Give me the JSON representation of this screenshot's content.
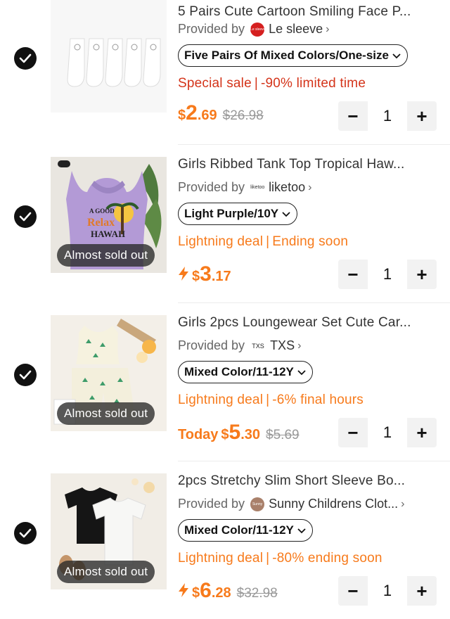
{
  "colors": {
    "accent": "#f77a1b",
    "sale": "#d4341a",
    "check": "#111111"
  },
  "items": [
    {
      "title": "5 Pairs Cute Cartoon Smiling Face P...",
      "provided_label": "Provided by",
      "shop_name": "Le sleeve",
      "shop_logo_text": "Le sleeve",
      "variant": "Five Pairs Of Mixed Colors/One-size",
      "promo": "Special sale | -90% limited time",
      "currency": "$",
      "price_int": "2",
      "price_dec": ".69",
      "original_price": "$26.98",
      "qty": "1"
    },
    {
      "title": "Girls Ribbed Tank Top Tropical Haw...",
      "provided_label": "Provided by",
      "shop_name": "liketoo",
      "shop_logo_text": "liketoo",
      "variant": "Light Purple/10Y",
      "badge": "Almost sold out",
      "promo": "Lightning deal | Ending soon",
      "currency": "$",
      "price_int": "3",
      "price_dec": ".17",
      "qty": "1"
    },
    {
      "title": "Girls 2pcs Loungewear Set Cute Car...",
      "provided_label": "Provided by",
      "shop_name": "TXS",
      "shop_logo_text": "TXS",
      "variant": "Mixed Color/11-12Y",
      "badge": "Almost sold out",
      "promo": "Lightning deal | -6% final hours",
      "today": "Today",
      "currency": "$",
      "price_int": "5",
      "price_dec": ".30",
      "original_price": "$5.69",
      "qty": "1"
    },
    {
      "title": "2pcs Stretchy Slim Short Sleeve Bo...",
      "provided_label": "Provided by",
      "shop_name": "Sunny Childrens Clot...",
      "shop_logo_text": "Sunny",
      "variant": "Mixed Color/11-12Y",
      "badge": "Almost sold out",
      "promo": "Lightning deal | -80% ending soon",
      "currency": "$",
      "price_int": "6",
      "price_dec": ".28",
      "original_price": "$32.98",
      "qty": "1"
    }
  ],
  "icons": {
    "check": "check-icon",
    "chevron": "chevron-right-icon",
    "dropdown": "chevron-down-icon",
    "bolt": "lightning-icon",
    "minus": "minus-icon",
    "plus": "plus-icon"
  },
  "stepper": {
    "minus": "−",
    "plus": "+"
  }
}
